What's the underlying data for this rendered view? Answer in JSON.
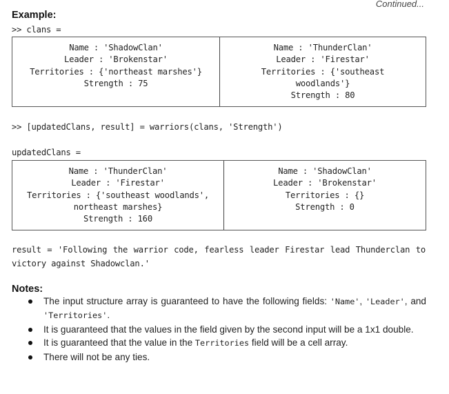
{
  "header": {
    "continued": "Continued..."
  },
  "example": {
    "heading": "Example:",
    "clans_prompt": ">> clans =",
    "clans": [
      {
        "lines": [
          "Name : 'ShadowClan'",
          "Leader : 'Brokenstar'",
          "Territories : {'northeast marshes'}",
          "Strength : 75"
        ]
      },
      {
        "lines": [
          "Name : 'ThunderClan'",
          "Leader : 'Firestar'",
          "Territories : {'southeast",
          "woodlands'}",
          "Strength : 80"
        ]
      }
    ],
    "call_line": ">> [updatedClans, result] = warriors(clans, 'Strength')",
    "updated_label": "updatedClans =",
    "updated_clans": [
      {
        "lines": [
          "Name : 'ThunderClan'",
          "Leader : 'Firestar'",
          "Territories : {'southeast woodlands',",
          "northeast marshes}",
          "Strength : 160"
        ]
      },
      {
        "lines": [
          "Name : 'ShadowClan'",
          "Leader : 'Brokenstar'",
          "Territories : {}",
          "Strength : 0"
        ]
      }
    ],
    "result_text": "result = 'Following the warrior code, fearless leader Firestar lead Thunderclan to victory against Shadowclan.'"
  },
  "notes": {
    "heading": "Notes:",
    "items": [
      {
        "parts": [
          {
            "text": "The input structure array is guaranteed to have the following fields: ",
            "code": false
          },
          {
            "text": "'Name'",
            "code": true
          },
          {
            "text": ", ",
            "code": false
          },
          {
            "text": "'Leader'",
            "code": true
          },
          {
            "text": ", and ",
            "code": false
          },
          {
            "text": "'Territories'",
            "code": true
          },
          {
            "text": ".",
            "code": false
          }
        ]
      },
      {
        "parts": [
          {
            "text": "It is guaranteed that the values in the field given by the second input will be a 1x1 double.",
            "code": false
          }
        ]
      },
      {
        "parts": [
          {
            "text": "It is guaranteed that the value in the ",
            "code": false
          },
          {
            "text": "Territories",
            "code": true
          },
          {
            "text": " field will be a cell array.",
            "code": false
          }
        ]
      },
      {
        "parts": [
          {
            "text": "There will not be any ties.",
            "code": false
          }
        ]
      }
    ]
  }
}
